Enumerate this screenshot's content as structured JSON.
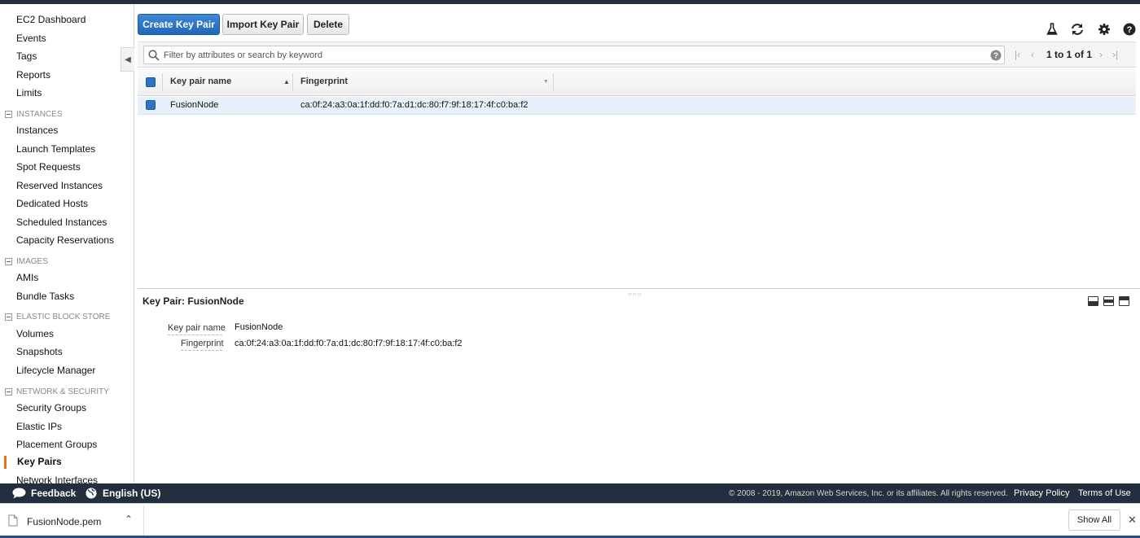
{
  "sidebar": {
    "items": [
      {
        "label": "EC2 Dashboard"
      },
      {
        "label": "Events"
      },
      {
        "label": "Tags"
      },
      {
        "label": "Reports"
      },
      {
        "label": "Limits"
      },
      {
        "label": "Instances"
      },
      {
        "label": "Launch Templates"
      },
      {
        "label": "Spot Requests"
      },
      {
        "label": "Reserved Instances"
      },
      {
        "label": "Dedicated Hosts"
      },
      {
        "label": "Scheduled Instances"
      },
      {
        "label": "Capacity Reservations"
      },
      {
        "label": "AMIs"
      },
      {
        "label": "Bundle Tasks"
      },
      {
        "label": "Volumes"
      },
      {
        "label": "Snapshots"
      },
      {
        "label": "Lifecycle Manager"
      },
      {
        "label": "Security Groups"
      },
      {
        "label": "Elastic IPs"
      },
      {
        "label": "Placement Groups"
      },
      {
        "label": "Key Pairs"
      },
      {
        "label": "Network Interfaces"
      }
    ],
    "sections": [
      {
        "label": "INSTANCES"
      },
      {
        "label": "IMAGES"
      },
      {
        "label": "ELASTIC BLOCK STORE"
      },
      {
        "label": "NETWORK & SECURITY"
      }
    ],
    "active_item": "Key Pairs",
    "accent_color": "#ec7211"
  },
  "toolbar": {
    "create_label": "Create Key Pair",
    "import_label": "Import Key Pair",
    "delete_label": "Delete",
    "icons": [
      "flask-icon",
      "refresh-icon",
      "gear-icon",
      "help-icon"
    ]
  },
  "filter": {
    "placeholder": "Filter by attributes or search by keyword",
    "pagination": "1 to 1 of 1"
  },
  "table": {
    "columns": [
      "Key pair name",
      "Fingerprint"
    ],
    "rows": [
      {
        "name": "FusionNode",
        "fingerprint": "ca:0f:24:a3:0a:1f:dd:f0:7a:d1:dc:80:f7:9f:18:17:4f:c0:ba:f2"
      }
    ]
  },
  "details": {
    "title": "Key Pair: FusionNode",
    "fields": [
      {
        "label": "Key pair name",
        "value": "FusionNode"
      },
      {
        "label": "Fingerprint",
        "value": "ca:0f:24:a3:0a:1f:dd:f0:7a:d1:dc:80:f7:9f:18:17:4f:c0:ba:f2"
      }
    ]
  },
  "footer": {
    "feedback": "Feedback",
    "language": "English (US)",
    "copyright": "© 2008 - 2019, Amazon Web Services, Inc. or its affiliates. All rights reserved.",
    "privacy": "Privacy Policy",
    "terms": "Terms of Use"
  },
  "downloads": {
    "file_name": "FusionNode.pem",
    "show_all": "Show All"
  },
  "colors": {
    "primary_button": "#1f67b9",
    "footer_bg": "#232f3e",
    "selected_row": "#e8f1fb"
  }
}
